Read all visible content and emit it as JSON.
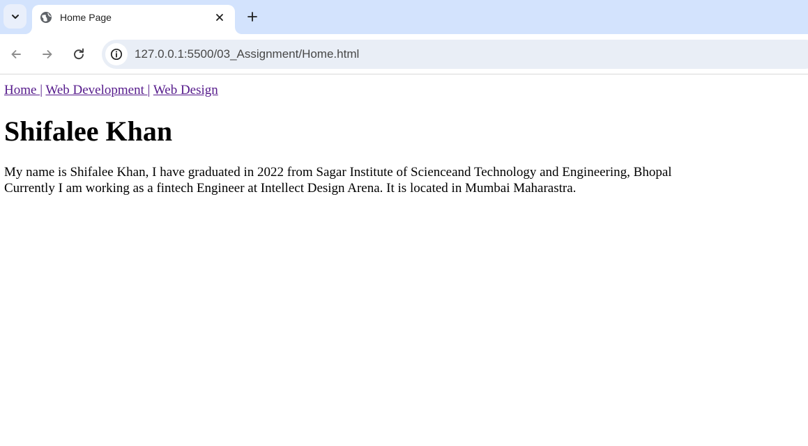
{
  "browser": {
    "tab": {
      "title": "Home Page",
      "favicon": "globe-icon"
    },
    "address_bar": {
      "url": "127.0.0.1:5500/03_Assignment/Home.html",
      "site_info_icon": "info-icon"
    },
    "colors": {
      "tabstrip_bg": "#d3e3fd",
      "omnibox_bg": "#e9eef6",
      "visited_link": "#551a8b"
    }
  },
  "page": {
    "nav": [
      {
        "label": "Home "
      },
      {
        "label": "Web Development "
      },
      {
        "label": "Web Design"
      }
    ],
    "nav_separator": "|",
    "heading": "Shifalee Khan",
    "bio_lines": [
      "My name is Shifalee Khan, I have graduated in 2022 from Sagar Institute of Scienceand Technology and Engineering, Bhopal",
      "Currently I am working as a fintech Engineer at Intellect Design Arena. It is located in Mumbai Maharastra."
    ]
  }
}
